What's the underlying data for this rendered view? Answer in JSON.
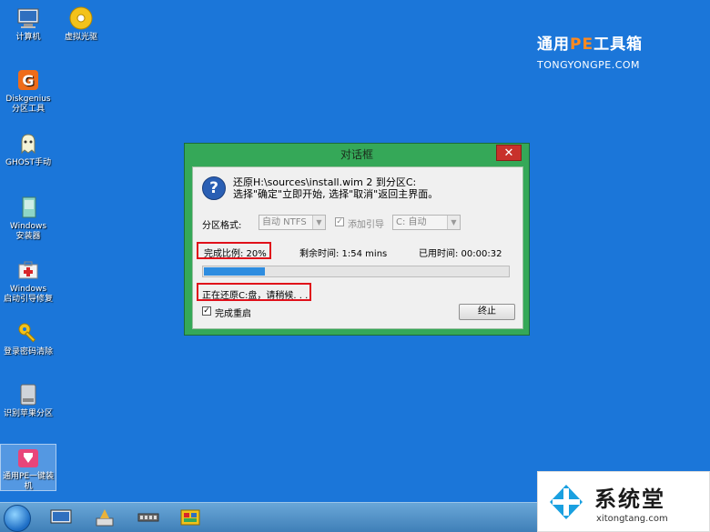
{
  "desktop_icons": [
    {
      "label": "计算机"
    },
    {
      "label": "虚拟光驱"
    },
    {
      "label": "Diskgenius\n分区工具"
    },
    {
      "label": "GHOST手动"
    },
    {
      "label": "Windows\n安装器"
    },
    {
      "label": "Windows\n启动引导修复"
    },
    {
      "label": "登录密码清除"
    },
    {
      "label": "识别苹果分区"
    },
    {
      "label": "通用PE一键装\n机"
    }
  ],
  "brand": {
    "title_pre": "通用",
    "title_pe": "PE",
    "title_post": "工具箱",
    "subtitle": "TONGYONGPE.COM"
  },
  "dialog": {
    "title": "对话框",
    "close": "✕",
    "message_line1": "还原H:\\sources\\install.wim 2 到分区C:",
    "message_line2": "选择\"确定\"立即开始, 选择\"取消\"返回主界面。",
    "format_label": "分区格式:",
    "format_value": "自动 NTFS",
    "add_boot_label": "添加引导",
    "add_boot_check": "✓",
    "drive_value": "C: 自动",
    "progress_label": "完成比例: 20%",
    "progress_percent": 20,
    "remaining_label": "剩余时间: 1:54 mins",
    "elapsed_label": "已用时间: 00:00:32",
    "status": "正在还原C:盘，请稍候. . .",
    "restart_label": "完成重启",
    "restart_check": "✓",
    "stop_button": "终止"
  },
  "watermark": {
    "title": "系统堂",
    "url": "xitongtang.com"
  },
  "colors": {
    "desktop": "#1b76d9",
    "dialog_frame": "#35a858",
    "highlight": "#e0101a",
    "progress": "#2e8de0"
  }
}
